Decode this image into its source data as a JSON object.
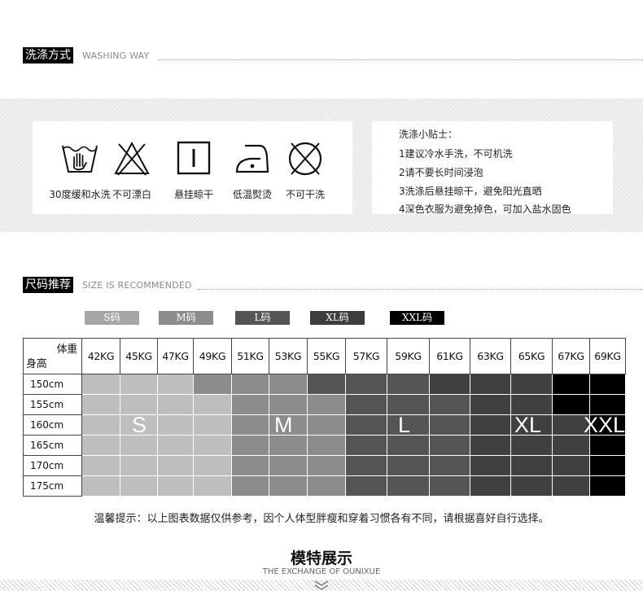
{
  "washing": {
    "title_cn": "洗涤方式",
    "title_en": "WASHING WAY",
    "symbols": [
      {
        "icon": "hand-wash-icon",
        "label": "30度缓和水洗"
      },
      {
        "icon": "no-bleach-icon",
        "label": "不可漂白"
      },
      {
        "icon": "line-dry-icon",
        "label": "悬挂晾干"
      },
      {
        "icon": "low-iron-icon",
        "label": "低温熨烫"
      },
      {
        "icon": "no-dry-clean-icon",
        "label": "不可干洗"
      }
    ],
    "tips": [
      "洗涤小贴士：",
      "1建议冷水手洗，不可机洗",
      "2请不要长时间浸泡",
      "3洗涤后悬挂晾干，避免阳光直晒",
      "4深色衣服为避免掉色，可加入盐水固色"
    ]
  },
  "sizes": {
    "title_cn": "尺码推荐",
    "title_en": "SIZE IS RECOMMENDED",
    "legend": [
      {
        "label": "S码",
        "color": "#a6a6a6"
      },
      {
        "label": "M码",
        "color": "#8c8c8c"
      },
      {
        "label": "L码",
        "color": "#555555"
      },
      {
        "label": "XL码",
        "color": "#3d3d3d"
      },
      {
        "label": "XXL码",
        "color": "#000000"
      }
    ],
    "corner_weight": "体重",
    "corner_height": "身高",
    "weights": [
      "42KG",
      "45KG",
      "47KG",
      "49KG",
      "51KG",
      "53KG",
      "55KG",
      "57KG",
      "59KG",
      "61KG",
      "63KG",
      "65KG",
      "67KG",
      "69KG"
    ],
    "heights": [
      "150cm",
      "155cm",
      "160cm",
      "165cm",
      "170cm",
      "175cm"
    ],
    "size_labels": [
      "S",
      "M",
      "L",
      "XL",
      "XXL"
    ],
    "note": "温馨提示：以上图表数据仅供参考，因个人体型胖瘦和穿着习惯各有不同，请根据喜好自行选择。"
  },
  "model": {
    "title": "模特展示",
    "subtitle": "THE EXCHANGE OF OUNIXUE"
  }
}
